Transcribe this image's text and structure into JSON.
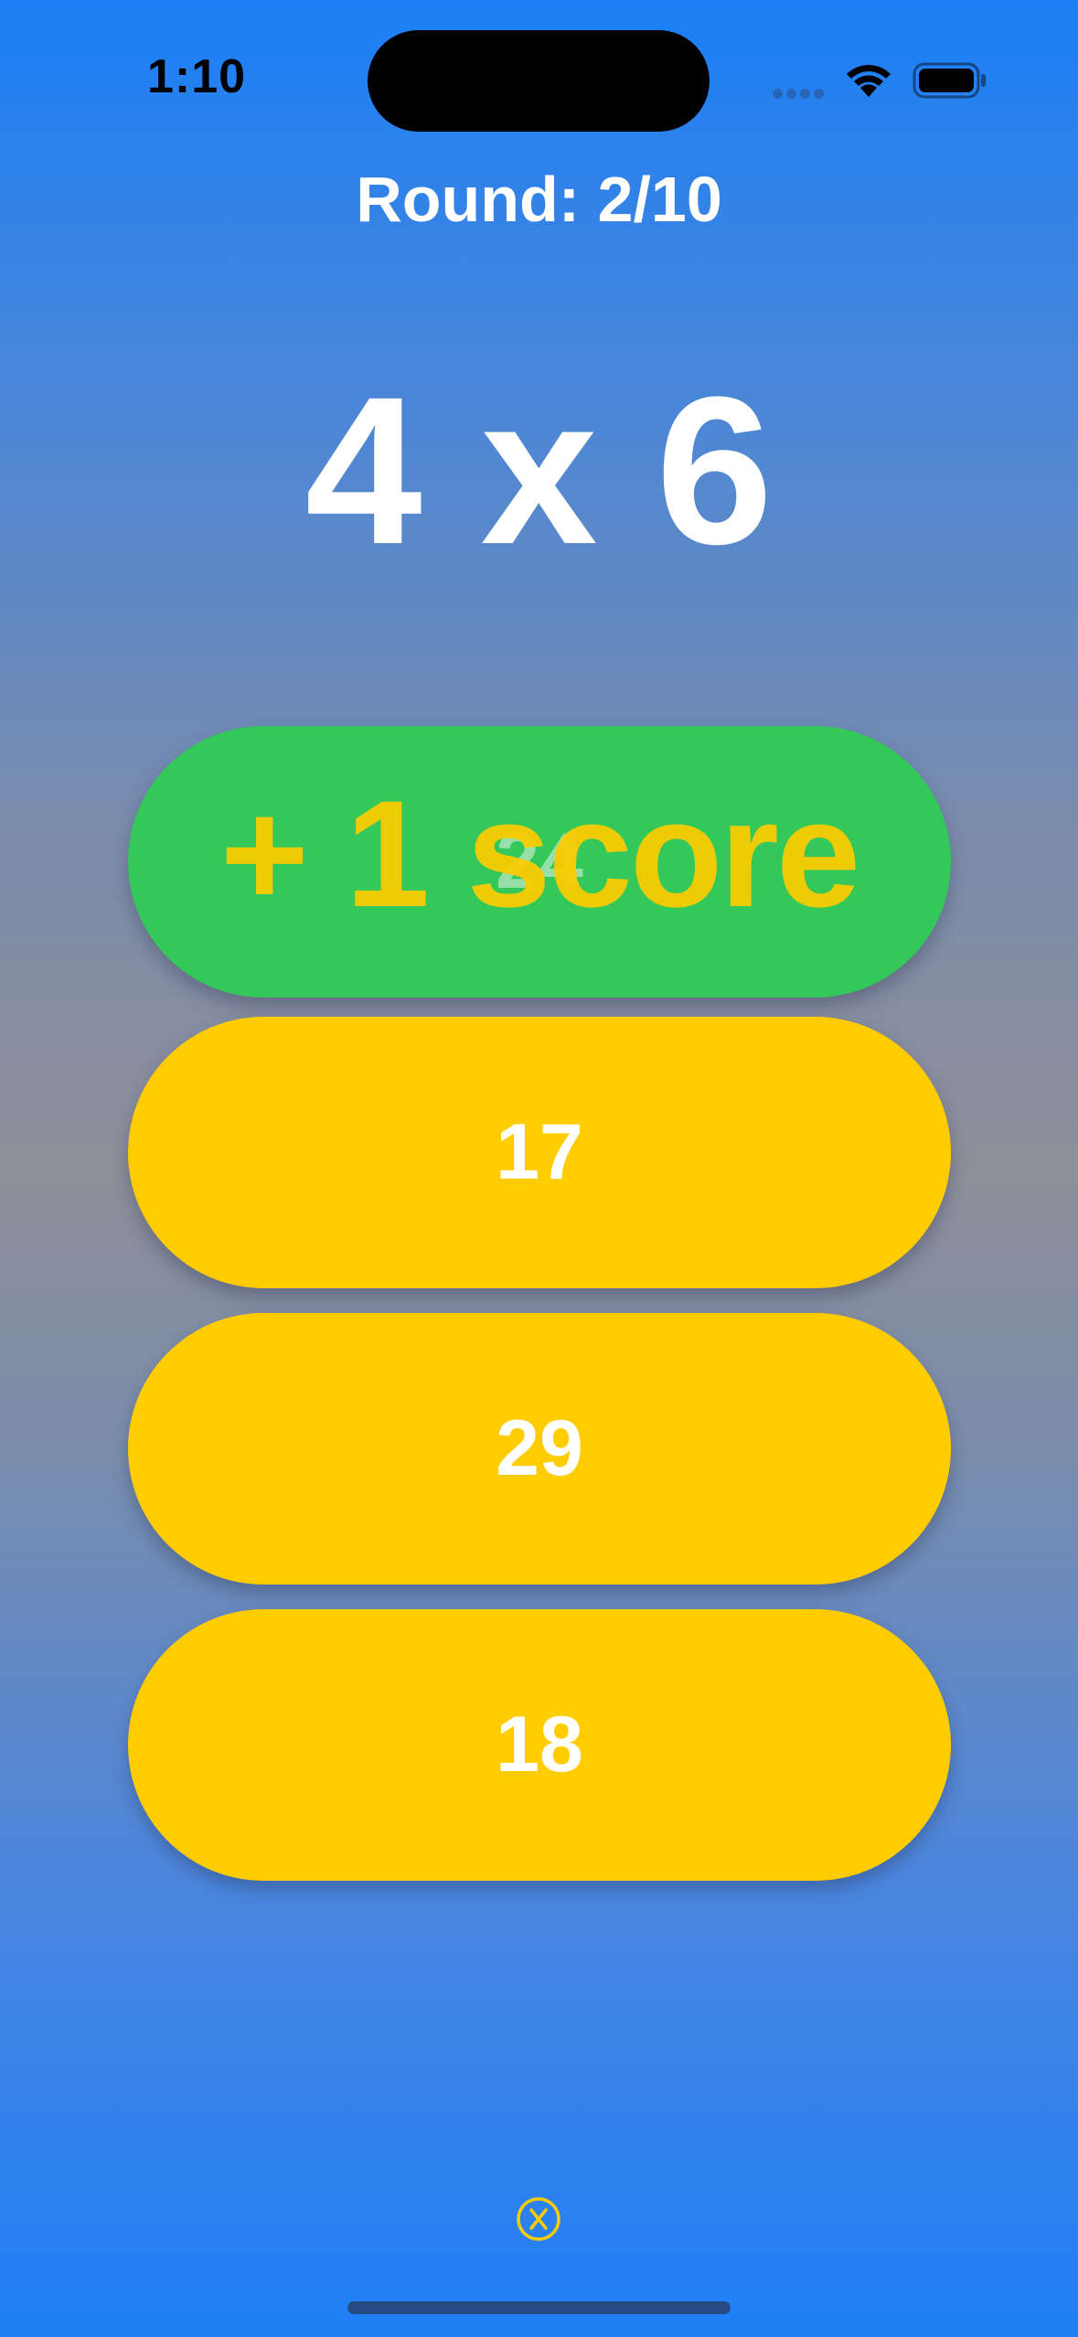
{
  "status_bar": {
    "time": "1:10"
  },
  "game": {
    "round_label": "Round: 2/10",
    "question": "4 x 6"
  },
  "answers": [
    {
      "label": "24",
      "state": "correct"
    },
    {
      "label": "17",
      "state": "default"
    },
    {
      "label": "29",
      "state": "default"
    },
    {
      "label": "18",
      "state": "default"
    }
  ],
  "feedback": {
    "score_popup": "+ 1 score"
  },
  "icons": {
    "signal": "cellular-signal-icon",
    "wifi": "wifi-icon",
    "battery": "battery-icon",
    "close": "close-icon"
  },
  "colors": {
    "answer_default": "#ffcc00",
    "answer_correct": "#34c759",
    "score_popup": "#ffcc00",
    "text": "#ffffff"
  }
}
